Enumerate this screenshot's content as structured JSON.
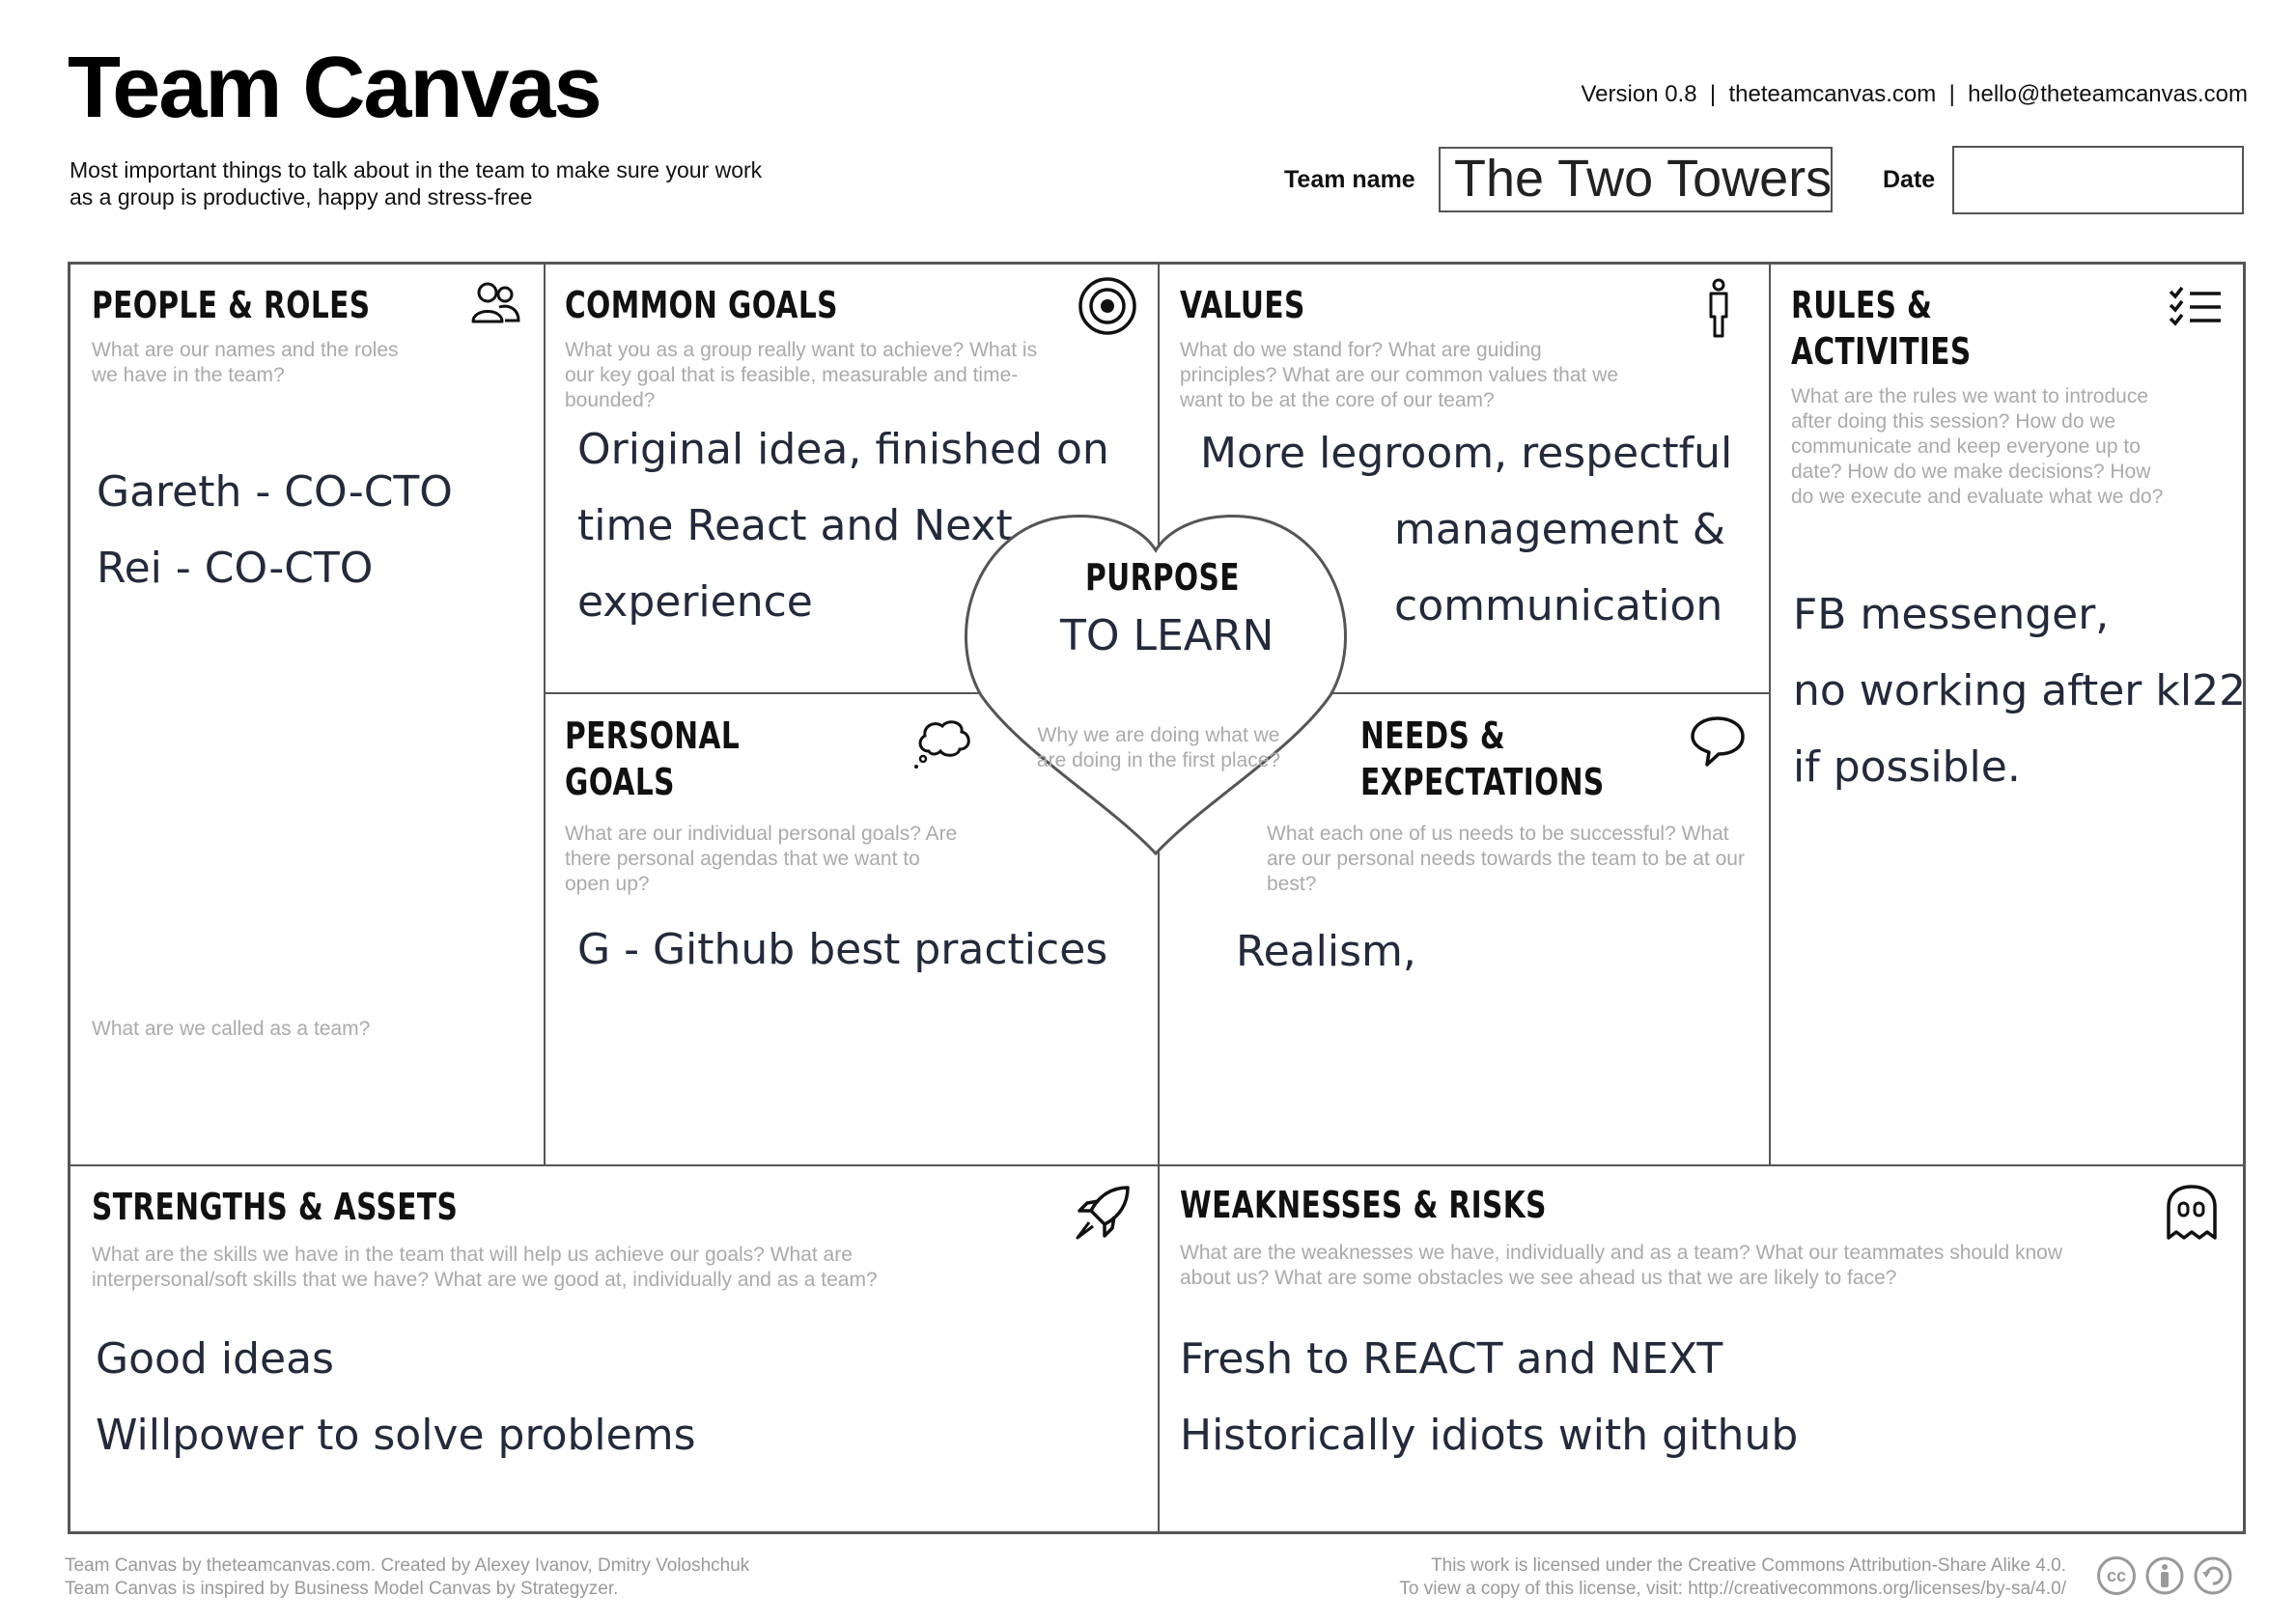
{
  "header": {
    "title": "Team Canvas",
    "subtitle": "Most important things to talk about in the team to make sure your work as a group is productive, happy and stress-free",
    "meta": "Version 0.8  |  theteamcanvas.com  |  hello@theteamcanvas.com",
    "team_name_label": "Team name",
    "team_name_value": "The Two Towers",
    "date_label": "Date",
    "date_value": ""
  },
  "sections": {
    "people_roles": {
      "title": "PEOPLE & ROLES",
      "hint": "What are our names and the roles we have in the team?",
      "bottom_hint": "What are we called as a team?",
      "entries": [
        "Gareth - CO-CTO",
        "Rei - CO-CTO"
      ]
    },
    "common_goals": {
      "title": "COMMON GOALS",
      "hint": "What you as a group really want to achieve? What is our key goal that is feasible, measurable and time-bounded?",
      "entries": [
        "Original idea, finished on",
        "time React and Next",
        "experience"
      ]
    },
    "values": {
      "title": "VALUES",
      "hint": "What do we stand for? What are guiding principles? What are our common values that we want to be at the core of our team?",
      "entries": [
        "More legroom, respectful",
        "management &",
        "communication"
      ]
    },
    "rules_activities": {
      "title_line1": "RULES &",
      "title_line2": "ACTIVITIES",
      "hint": "What are the rules we want to introduce after doing this session? How do we communicate and keep everyone up to date? How do we make decisions? How do we execute and evaluate what we do?",
      "entries": [
        "FB messenger,",
        "no working after kl22",
        "if possible."
      ]
    },
    "purpose": {
      "title": "PURPOSE",
      "value": "TO LEARN",
      "hint": "Why we are doing what we are doing in the first place?"
    },
    "personal_goals": {
      "title_line1": "PERSONAL",
      "title_line2": "GOALS",
      "hint": "What are our individual personal goals? Are there personal agendas that we want to open up?",
      "entries": [
        "G - Github best practices"
      ]
    },
    "needs_expectations": {
      "title_line1": "NEEDS &",
      "title_line2": "EXPECTATIONS",
      "hint": "What each one of us needs to be successful? What are our personal needs towards the team to be at our best?",
      "entries": [
        "Realism,"
      ]
    },
    "strengths_assets": {
      "title": "STRENGTHS & ASSETS",
      "hint": "What are the skills we have in the team that will help us achieve our goals? What are interpersonal/soft skills that we have? What are we good at, individually and as a team?",
      "entries": [
        "Good ideas",
        "Willpower to solve problems"
      ]
    },
    "weaknesses_risks": {
      "title": "WEAKNESSES & RISKS",
      "hint": "What are the weaknesses we have, individually and as a team? What our teammates should know about us? What are some obstacles we see ahead us that we are likely to face?",
      "entries": [
        "Fresh to REACT and NEXT",
        "Historically idiots with github"
      ]
    }
  },
  "footer": {
    "left": "Team Canvas by theteamcanvas.com. Created by Alexey Ivanov, Dmitry Voloshchuk\nTeam Canvas is inspired by Business Model Canvas by Strategyzer.",
    "right": "This work is licensed under the Creative Commons Attribution-Share Alike 4.0.\nTo view a copy of this license, visit: http://creativecommons.org/licenses/by-sa/4.0/",
    "cc_badge": "cc"
  },
  "icons": [
    "people-icon",
    "target-icon",
    "person-standing-icon",
    "checklist-icon",
    "thought-bubble-icon",
    "speech-bubble-icon",
    "rocket-icon",
    "ghost-icon",
    "creative-commons-icon",
    "attribution-icon",
    "share-alike-icon"
  ]
}
